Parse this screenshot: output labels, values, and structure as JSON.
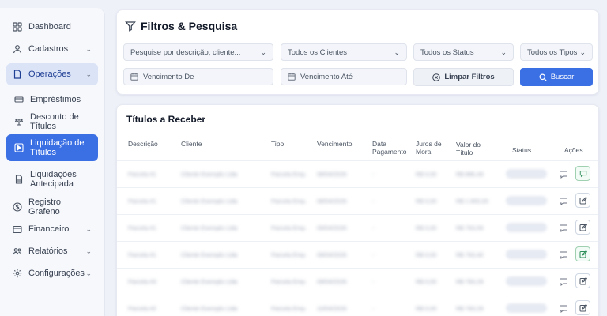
{
  "sidebar": {
    "items": [
      {
        "label": "Dashboard",
        "icon": "grid-icon"
      },
      {
        "label": "Cadastros",
        "icon": "user-icon",
        "chevron": true
      },
      {
        "label": "Operações",
        "icon": "document-icon",
        "chevron": true
      },
      {
        "label": "Empréstimos",
        "icon": "cash-icon"
      },
      {
        "label": "Desconto de Títulos",
        "icon": "percent-icon"
      },
      {
        "label": "Liquidação de Títulos",
        "icon": "play-box-icon"
      },
      {
        "label": "Liquidações Antecipada",
        "icon": "file-icon"
      },
      {
        "label": "Registro Grafeno",
        "icon": "coin-icon"
      },
      {
        "label": "Financeiro",
        "icon": "wallet-icon",
        "chevron": true
      },
      {
        "label": "Relatórios",
        "icon": "people-icon",
        "chevron": true
      },
      {
        "label": "Configurações",
        "icon": "gear-icon",
        "chevron": true
      }
    ]
  },
  "filters": {
    "title": "Filtros & Pesquisa",
    "search_placeholder": "Pesquise por descrição, cliente...",
    "clients": "Todos os Clientes",
    "status": "Todos os Status",
    "types": "Todos os Tipos",
    "due_from": "Vencimento De",
    "due_to": "Vencimento Até",
    "clear_label": "Limpar Filtros",
    "search_label": "Buscar"
  },
  "table": {
    "title": "Títulos a Receber",
    "headers": {
      "descricao": "Descrição",
      "cliente": "Cliente",
      "tipo": "Tipo",
      "vencimento": "Vencimento",
      "data_pagamento": "Data Pagamento",
      "juros": "Juros de Mora",
      "valor": "Valor do Título",
      "status": "Status",
      "acoes": "Ações"
    },
    "rows": [
      {
        "descricao": "Parcela #1",
        "cliente": "Cliente Exemplo Ltda",
        "tipo": "Parcela Emp.",
        "vencimento": "08/04/2026",
        "data_pagamento": "-",
        "juros": "R$ 0,00",
        "valor": "R$ 886,49"
      },
      {
        "descricao": "Parcela #1",
        "cliente": "Cliente Exemplo Ltda",
        "tipo": "Parcela Emp.",
        "vencimento": "08/04/2026",
        "data_pagamento": "-",
        "juros": "R$ 0,00",
        "valor": "R$ 1.900,00"
      },
      {
        "descricao": "Parcela #1",
        "cliente": "Cliente Exemplo Ltda",
        "tipo": "Parcela Emp.",
        "vencimento": "09/04/2026",
        "data_pagamento": "-",
        "juros": "R$ 0,00",
        "valor": "R$ 763,59"
      },
      {
        "descricao": "Parcela #1",
        "cliente": "Cliente Exemplo Ltda",
        "tipo": "Parcela Emp.",
        "vencimento": "09/04/2026",
        "data_pagamento": "-",
        "juros": "R$ 0,00",
        "valor": "R$ 763,40"
      },
      {
        "descricao": "Parcela #3",
        "cliente": "Cliente Exemplo Ltda",
        "tipo": "Parcela Emp.",
        "vencimento": "09/04/2026",
        "data_pagamento": "-",
        "juros": "R$ 0,00",
        "valor": "R$ 783,28"
      },
      {
        "descricao": "Parcela #2",
        "cliente": "Cliente Exemplo Ltda",
        "tipo": "Parcela Emp.",
        "vencimento": "10/04/2026",
        "data_pagamento": "-",
        "juros": "R$ 0,00",
        "valor": "R$ 783,28"
      }
    ]
  },
  "colors": {
    "accent": "#3b6fe4",
    "background": "#eef1f8",
    "success": "#2f8f5b"
  }
}
